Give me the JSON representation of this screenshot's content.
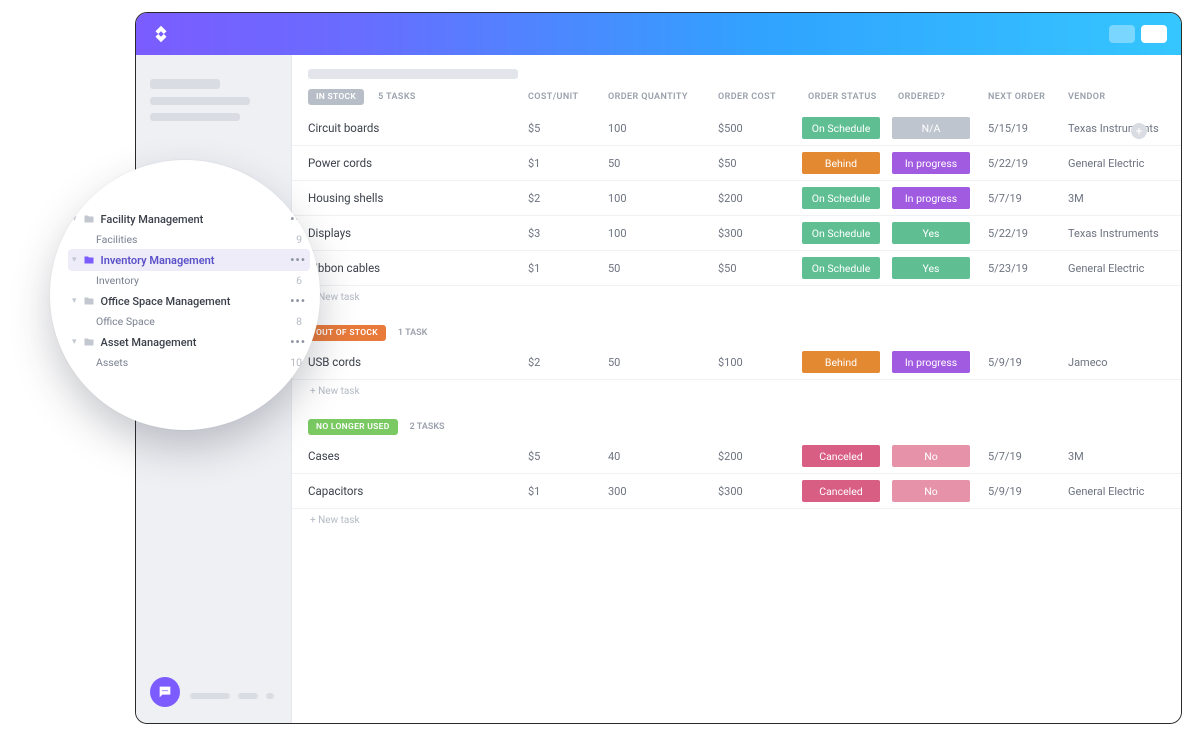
{
  "app": {
    "logo_label": "ClickUp"
  },
  "sidebar": {
    "folders": [
      {
        "name": "Facility Management",
        "children": [
          {
            "name": "Facilities",
            "count": "9"
          }
        ]
      },
      {
        "name": "Inventory Management",
        "selected": true,
        "children": [
          {
            "name": "Inventory",
            "count": "6"
          }
        ]
      },
      {
        "name": "Office Space Management",
        "children": [
          {
            "name": "Office Space",
            "count": "8"
          }
        ]
      },
      {
        "name": "Asset Management",
        "children": [
          {
            "name": "Assets",
            "count": "10"
          }
        ]
      }
    ]
  },
  "columns": {
    "cost_unit": "COST/UNIT",
    "order_qty": "ORDER QUANTITY",
    "order_cost": "ORDER COST",
    "order_status": "ORDER STATUS",
    "ordered": "ORDERED?",
    "next_order": "NEXT ORDER",
    "vendor": "VENDOR"
  },
  "groups": [
    {
      "status_label": "IN STOCK",
      "status_class": "instock",
      "task_count": "5 TASKS",
      "rows": [
        {
          "name": "Circuit boards",
          "cost": "$5",
          "qty": "100",
          "ordercost": "$500",
          "status": "On Schedule",
          "status_class": "green",
          "ordered": "N/A",
          "ordered_class": "grey",
          "next": "5/15/19",
          "vendor": "Texas Instruments"
        },
        {
          "name": "Power cords",
          "cost": "$1",
          "qty": "50",
          "ordercost": "$50",
          "status": "Behind",
          "status_class": "orange",
          "ordered": "In progress",
          "ordered_class": "purple",
          "next": "5/22/19",
          "vendor": "General Electric"
        },
        {
          "name": "Housing shells",
          "cost": "$2",
          "qty": "100",
          "ordercost": "$200",
          "status": "On Schedule",
          "status_class": "green",
          "ordered": "In progress",
          "ordered_class": "purple",
          "next": "5/7/19",
          "vendor": "3M"
        },
        {
          "name": "Displays",
          "cost": "$3",
          "qty": "100",
          "ordercost": "$300",
          "status": "On Schedule",
          "status_class": "green",
          "ordered": "Yes",
          "ordered_class": "yellowgreen",
          "next": "5/22/19",
          "vendor": "Texas Instruments"
        },
        {
          "name": "Ribbon cables",
          "cost": "$1",
          "qty": "50",
          "ordercost": "$50",
          "status": "On Schedule",
          "status_class": "green",
          "ordered": "Yes",
          "ordered_class": "yellowgreen",
          "next": "5/23/19",
          "vendor": "General Electric"
        }
      ]
    },
    {
      "status_label": "OUT OF STOCK",
      "status_class": "outstock",
      "task_count": "1 TASK",
      "rows": [
        {
          "name": "USB cords",
          "cost": "$2",
          "qty": "50",
          "ordercost": "$100",
          "status": "Behind",
          "status_class": "orange",
          "ordered": "In progress",
          "ordered_class": "purple",
          "next": "5/9/19",
          "vendor": "Jameco"
        }
      ]
    },
    {
      "status_label": "NO LONGER USED",
      "status_class": "nolonger",
      "task_count": "2 TASKS",
      "rows": [
        {
          "name": "Cases",
          "cost": "$5",
          "qty": "40",
          "ordercost": "$200",
          "status": "Canceled",
          "status_class": "pink",
          "ordered": "No",
          "ordered_class": "pinklight",
          "next": "5/7/19",
          "vendor": "3M"
        },
        {
          "name": "Capacitors",
          "cost": "$1",
          "qty": "300",
          "ordercost": "$300",
          "status": "Canceled",
          "status_class": "pink",
          "ordered": "No",
          "ordered_class": "pinklight",
          "next": "5/9/19",
          "vendor": "General Electric"
        }
      ]
    }
  ],
  "new_task_label": "+ New task"
}
